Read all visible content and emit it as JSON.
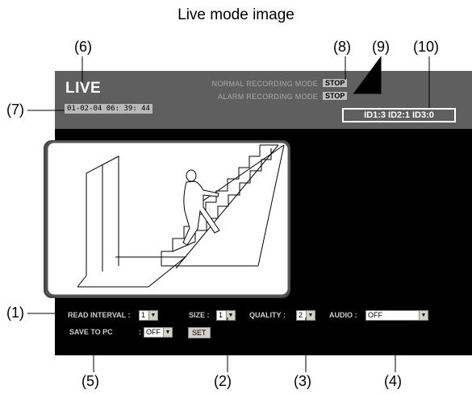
{
  "caption": "Live mode image",
  "header": {
    "title": "LIVE",
    "datetime": "01-02-04  06: 39: 44",
    "normal_label": "NORMAL RECORDING MODE",
    "normal_status": "STOP",
    "alarm_label": "ALARM RECORDING MODE",
    "alarm_status": "STOP",
    "ids": "ID1:3 ID2:1 ID3:0"
  },
  "controls": {
    "read_interval_label": "READ INTERVAL :",
    "read_interval_value": "1",
    "size_label": "SIZE :",
    "size_value": "1",
    "quality_label": "QUALITY :",
    "quality_value": "2",
    "audio_label": "AUDIO :",
    "audio_value": "OFF",
    "save_label": "SAVE TO PC",
    "save_colon": ":",
    "save_value": "OFF",
    "set_label": "SET"
  },
  "callouts": {
    "c1": "(1)",
    "c2": "(2)",
    "c3": "(3)",
    "c4": "(4)",
    "c5": "(5)",
    "c6": "(6)",
    "c7": "(7)",
    "c8": "(8)",
    "c9": "(9)",
    "c10": "(10)"
  },
  "icons": {
    "dropdown": "chevron-down-icon",
    "camera_image": "staircase-figure-image"
  },
  "colors": {
    "panel": "#000000",
    "header": "#5f5f5f",
    "label_text": "#a9a9a9"
  }
}
